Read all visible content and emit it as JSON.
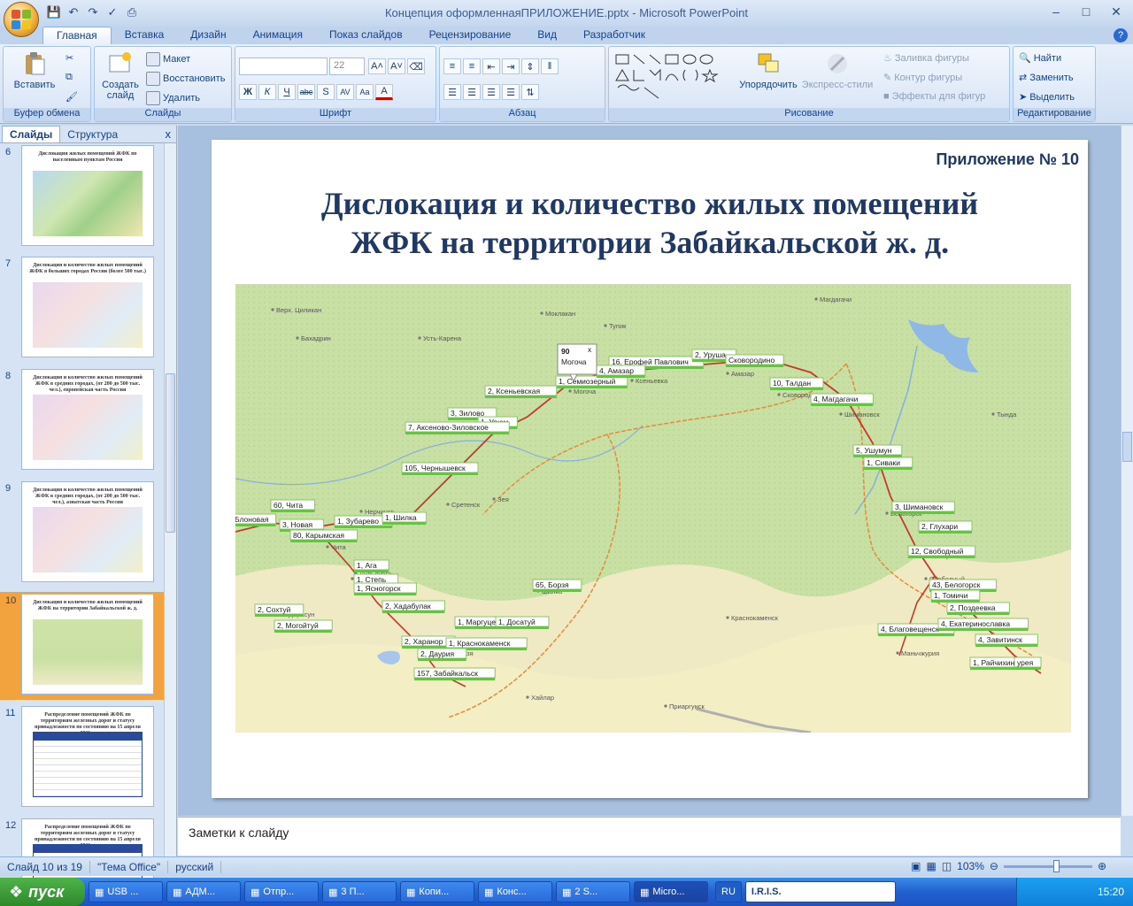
{
  "window": {
    "title": "Концепция оформленнаяПРИЛОЖЕНИЕ.pptx - Microsoft PowerPoint"
  },
  "ribbon_tabs": [
    "Главная",
    "Вставка",
    "Дизайн",
    "Анимация",
    "Показ слайдов",
    "Рецензирование",
    "Вид",
    "Разработчик"
  ],
  "ribbon": {
    "clipboard": {
      "paste": "Вставить",
      "label": "Буфер обмена"
    },
    "slides": {
      "create": "Создать слайд",
      "layout": "Макет",
      "reset": "Восстановить",
      "delete": "Удалить",
      "label": "Слайды"
    },
    "font": {
      "size": "22",
      "label": "Шрифт",
      "bold": "Ж",
      "italic": "К",
      "underline": "Ч",
      "strike": "abc",
      "shadow": "S",
      "spacing": "AV",
      "case": "Aa"
    },
    "paragraph": {
      "label": "Абзац"
    },
    "drawing": {
      "arrange": "Упорядочить",
      "styles": "Экспресс-стили",
      "fill": "Заливка фигуры",
      "outline": "Контур фигуры",
      "effects": "Эффекты для фигур",
      "label": "Рисование"
    },
    "editing": {
      "find": "Найти",
      "replace": "Заменить",
      "select": "Выделить",
      "label": "Редактирование"
    }
  },
  "left_panel": {
    "tabs": [
      "Слайды",
      "Структура"
    ],
    "close": "x",
    "thumbnails": [
      {
        "num": "6",
        "title": "Дислокация жилых помещений ЖФК по населенным пунктам России"
      },
      {
        "num": "7",
        "title": "Дислокация и количество жилых помещений ЖФК в больших городах России (более 500 тыс.)"
      },
      {
        "num": "8",
        "title": "Дислокация и количество жилых помещений ЖФК в средних городах, (от 200 до 500 тыс. чел.), европейская часть России"
      },
      {
        "num": "9",
        "title": "Дислокация и количество жилых помещений ЖФК в средних городах, (от 200 до 500 тыс. чел.), азиатская часть России"
      },
      {
        "num": "10",
        "title": "Дислокация и количество жилых помещений ЖФК на территории Забайкальской ж. д."
      },
      {
        "num": "11",
        "title": "Распределение помещений ЖФК по территориям железных дорог и статусу принадлежности по состоянию на 15 апреля 2011 г."
      },
      {
        "num": "12",
        "title": "Распределение помещений ЖФК по территориям железных дорог и статусу принадлежности по состоянию на 15 апреля 2011 г."
      }
    ]
  },
  "slide": {
    "appendix": "Приложение № 10",
    "title_line1": "Дислокация и количество жилых помещений",
    "title_line2": "ЖФК на территории Забайкальской ж. д.",
    "popup": {
      "count": "90",
      "name": "Могоча",
      "close": "x"
    },
    "map_markers": [
      "1, Семиозерный",
      "16, Ерофей Павлович",
      "2, Уруша",
      "Сковородино",
      "4, Амазар",
      "2, Ксеньевская",
      "10, Талдан",
      "4, Магдагачи",
      "3, Зилово",
      "1, Урюм",
      "7, Аксеново-Зиловское",
      "105, Чернышевск",
      "5, Ушумун",
      "1, Сиваки",
      "60, Чита",
      "Блоновая",
      "3, Новая",
      "1, Зубарево",
      "1, Шилка",
      "80, Карымская",
      "3, Шимановск",
      "2, Глухари",
      "12, Свободный",
      "1, Ага",
      "1, Степь",
      "1, Ясногорск",
      "65, Борзя",
      "43, Белогорск",
      "1, Томичи",
      "2, Поздеевка",
      "2, Сохтуй",
      "2, Хадабулак",
      "2, Могойтуй",
      "1, Маргуцек",
      "1, Досатуй",
      "4, Благовещенск",
      "4, Екатеринославка",
      "2, Харанор",
      "1, Краснокаменск",
      "4, Завитинск",
      "2, Даурия",
      "1, Райчихинск",
      "157, Забайкальск",
      "урея"
    ],
    "map_towns": [
      "Тупик",
      "Моклакан",
      "Усть-Карена",
      "Бахадрин",
      "Верх. Циликан",
      "Могоча",
      "Ксеньевка",
      "Амазар",
      "Сковородино",
      "Магдагачи",
      "Тында",
      "Зея",
      "Сретенск",
      "Нерчинск",
      "Шилка",
      "Борзя",
      "Краснокаменск",
      "Приаргунск",
      "Хайлар",
      "Маньчжурия",
      "Благовещенск",
      "Свободный",
      "Белогорск",
      "Шимановск",
      "Тыгда",
      "Чита",
      "Дарасун",
      "Могойтуй",
      "Дульдурга",
      "Ага"
    ]
  },
  "notes": {
    "placeholder": "Заметки к слайду"
  },
  "status": {
    "slide": "Слайд 10 из 19",
    "theme": "\"Тема Office\"",
    "lang": "русский",
    "zoom": "103%"
  },
  "taskbar": {
    "start": "пуск",
    "buttons": [
      "USB ...",
      "АДМ...",
      "Отпр...",
      "3 П...",
      "Копи...",
      "Конс...",
      "2 S...",
      "Micro..."
    ],
    "lang": "RU",
    "iris": "I.R.I.S.",
    "time": "15:20"
  },
  "colors": {
    "title": "#1f3864",
    "selected_thumb": "#f3a33e",
    "ribbon": "#dbe7f7",
    "map_green": "#c7dfa0",
    "map_yellow": "#f6f0c2"
  }
}
